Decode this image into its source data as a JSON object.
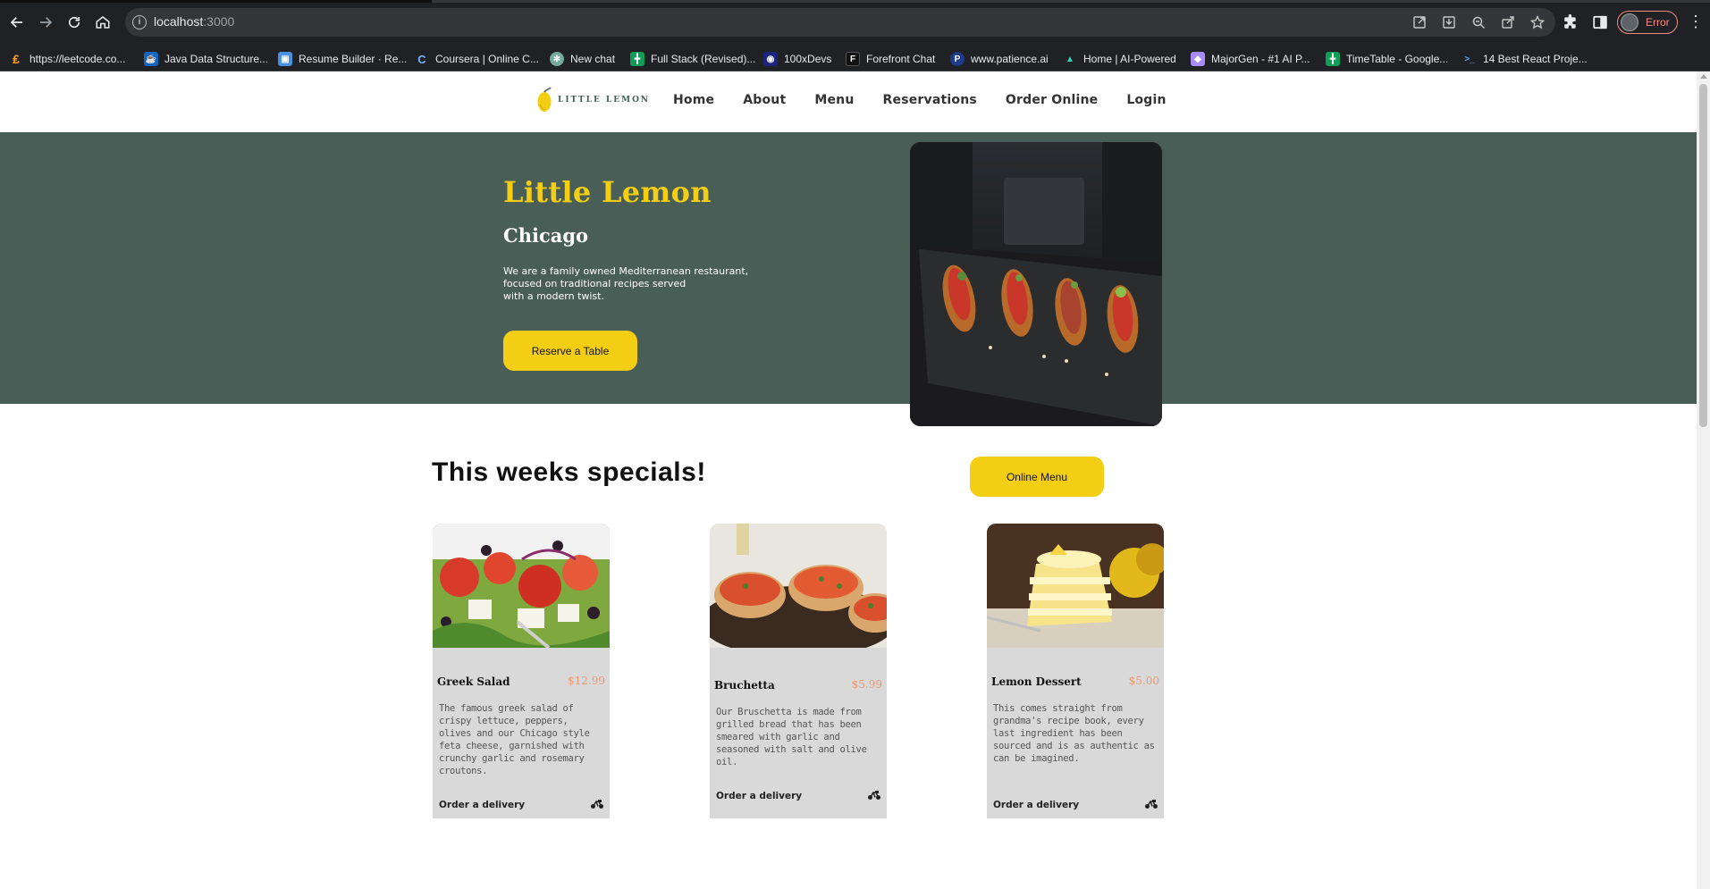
{
  "browser": {
    "url_host": "localhost",
    "url_port": ":3000",
    "profile_status": "Error",
    "menu_glyph": "⋮",
    "bookmarks": [
      {
        "label": "https://leetcode.co...",
        "icon": "leetcode-icon",
        "color": "#f89f1b"
      },
      {
        "label": "Java Data Structure...",
        "icon": "java-icon",
        "color": "#1565c0"
      },
      {
        "label": "Resume Builder · Re...",
        "icon": "resume-icon",
        "color": "#4a90e2"
      },
      {
        "label": "Coursera | Online C...",
        "icon": "coursera-icon",
        "color": "#0056d2"
      },
      {
        "label": "New chat",
        "icon": "chatgpt-icon",
        "color": "#74aa9c"
      },
      {
        "label": "Full Stack (Revised)...",
        "icon": "sheets-icon",
        "color": "#0f9d58"
      },
      {
        "label": "100xDevs",
        "icon": "devs-icon",
        "color": "#1a237e"
      },
      {
        "label": "Forefront Chat",
        "icon": "forefront-icon",
        "color": "#111111"
      },
      {
        "label": "www.patience.ai",
        "icon": "patience-icon",
        "color": "#1e3a8a"
      },
      {
        "label": "Home | AI-Powered",
        "icon": "home-ai-icon",
        "color": "#0d9488"
      },
      {
        "label": "MajorGen - #1 AI P...",
        "icon": "majorgen-icon",
        "color": "#a78bfa"
      },
      {
        "label": "TimeTable - Google...",
        "icon": "sheets-icon",
        "color": "#0f9d58"
      },
      {
        "label": "14 Best React Proje...",
        "icon": "terminal-icon",
        "color": "#3b82f6"
      }
    ]
  },
  "site": {
    "logo_text": "LITTLE LEMON",
    "nav": [
      "Home",
      "About",
      "Menu",
      "Reservations",
      "Order Online",
      "Login"
    ],
    "hero": {
      "title": "Little Lemon",
      "subtitle": "Chicago",
      "description_lines": [
        "We are a family owned Mediterranean restaurant,",
        "focused on traditional recipes served",
        "with a modern twist."
      ],
      "cta": "Reserve a Table"
    },
    "specials": {
      "title": "This weeks specials!",
      "menu_button": "Online Menu",
      "cards": [
        {
          "name": "Greek Salad",
          "price": "$12.99",
          "description": "The famous greek salad of crispy lettuce, peppers, olives and our Chicago style feta cheese, garnished with crunchy garlic and rosemary croutons.",
          "order": "Order a delivery"
        },
        {
          "name": "Bruchetta",
          "price": "$5.99",
          "description": "Our Bruschetta is made from grilled bread that has been smeared with garlic and seasoned with salt and olive oil.",
          "order": "Order a delivery"
        },
        {
          "name": "Lemon Dessert",
          "price": "$5.00",
          "description": "This comes straight from grandma's recipe book, every last ingredient has been sourced and is as authentic as can be imagined.",
          "order": "Order a delivery"
        }
      ]
    }
  },
  "colors": {
    "primary_green": "#495e57",
    "primary_yellow": "#f4ce14",
    "price_salmon": "#ee9972",
    "card_gray": "#d9d9d9"
  }
}
